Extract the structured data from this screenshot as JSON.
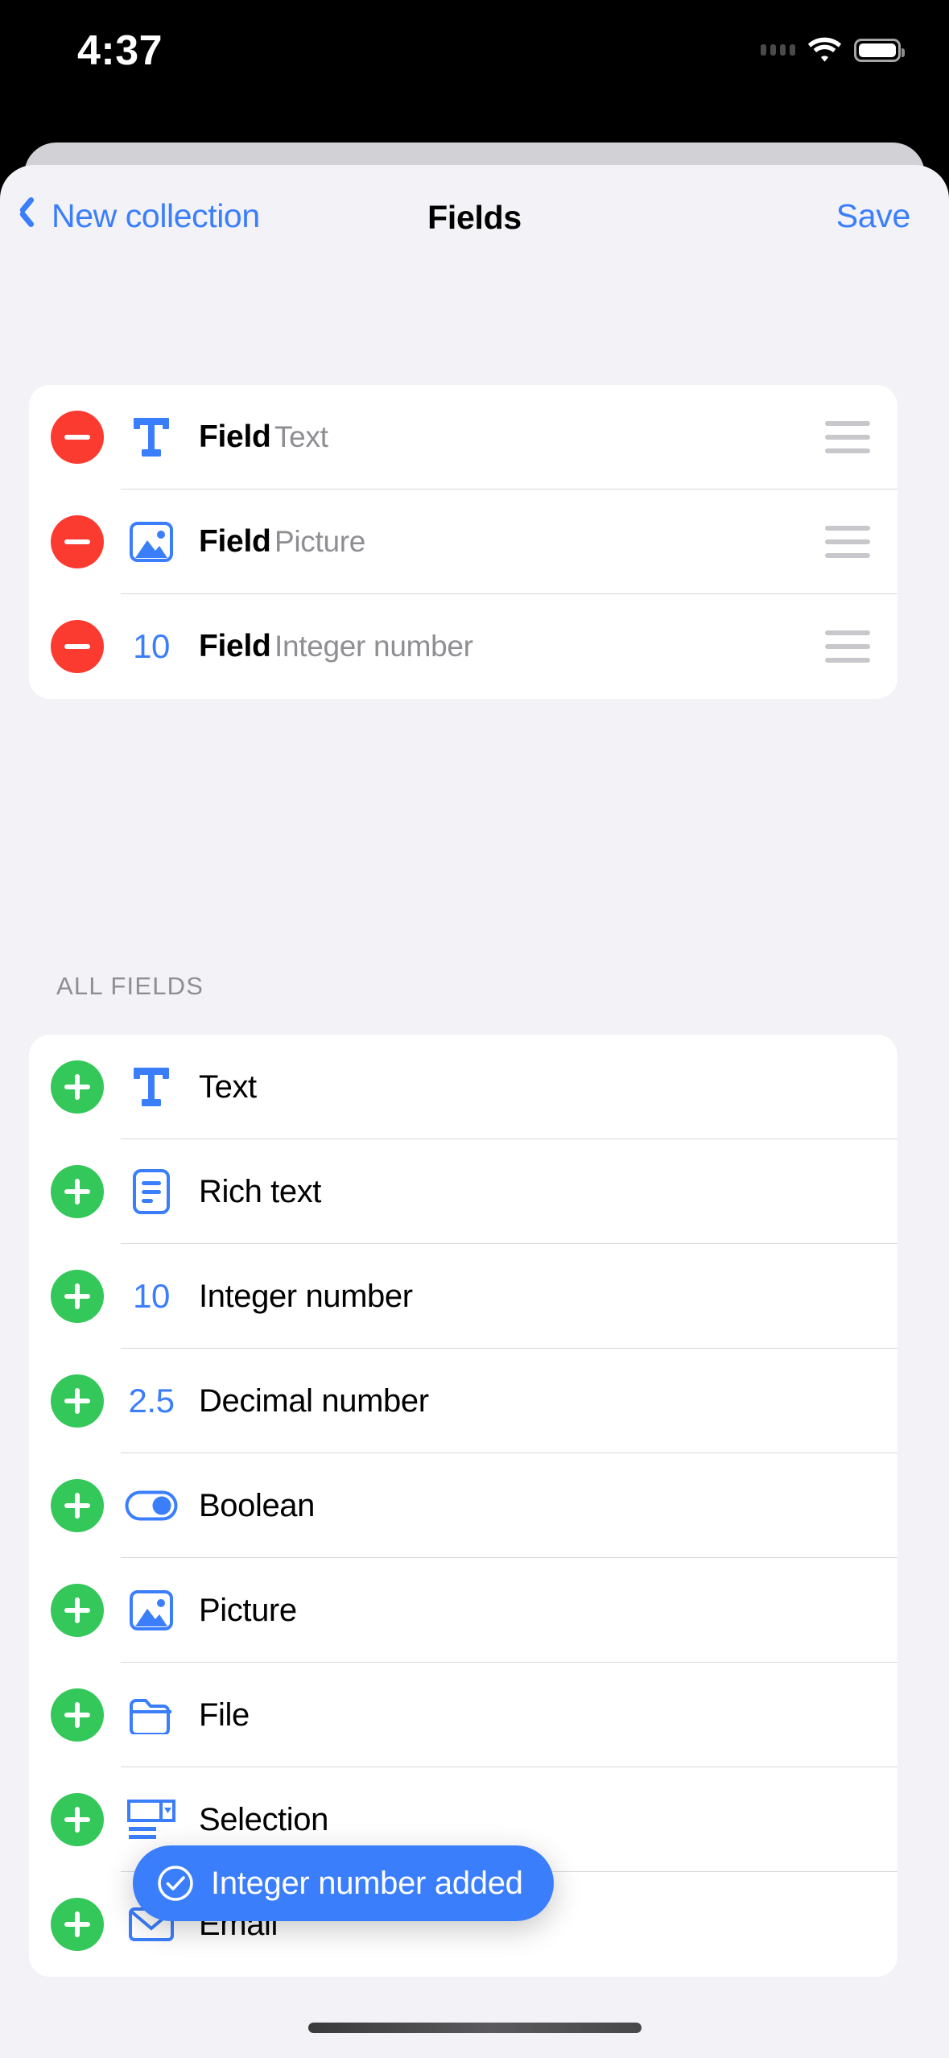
{
  "status_bar": {
    "time": "4:37",
    "wifi_icon": "wifi-icon",
    "battery_icon": "battery-icon",
    "signal_icon": "signal-dots-icon"
  },
  "nav": {
    "back_label": "New collection",
    "back_icon": "chevron-left-icon",
    "title": "Fields",
    "save_label": "Save"
  },
  "selected_fields": {
    "rows": [
      {
        "remove_icon": "minus-circle-icon",
        "type_icon": "text-T-icon",
        "title": "Field",
        "subtitle": "Text",
        "grip_icon": "drag-handle-icon"
      },
      {
        "remove_icon": "minus-circle-icon",
        "type_icon": "picture-icon",
        "title": "Field",
        "subtitle": "Picture",
        "grip_icon": "drag-handle-icon"
      },
      {
        "remove_icon": "minus-circle-icon",
        "type_icon": "integer-10-icon",
        "title": "Field",
        "subtitle": "Integer number",
        "grip_icon": "drag-handle-icon"
      }
    ]
  },
  "all_fields": {
    "header": "ALL FIELDS",
    "rows": [
      {
        "add_icon": "plus-circle-icon",
        "type_icon": "text-T-icon",
        "label": "Text"
      },
      {
        "add_icon": "plus-circle-icon",
        "type_icon": "rich-text-icon",
        "label": "Rich text"
      },
      {
        "add_icon": "plus-circle-icon",
        "type_icon": "integer-10-icon",
        "label": "Integer number"
      },
      {
        "add_icon": "plus-circle-icon",
        "type_icon": "decimal-2-5-icon",
        "label": "Decimal number"
      },
      {
        "add_icon": "plus-circle-icon",
        "type_icon": "toggle-icon",
        "label": "Boolean"
      },
      {
        "add_icon": "plus-circle-icon",
        "type_icon": "picture-icon",
        "label": "Picture"
      },
      {
        "add_icon": "plus-circle-icon",
        "type_icon": "folder-icon",
        "label": "File"
      },
      {
        "add_icon": "plus-circle-icon",
        "type_icon": "selection-icon",
        "label": "Selection"
      },
      {
        "add_icon": "plus-circle-icon",
        "type_icon": "envelope-icon",
        "label": "Email"
      }
    ],
    "icon_glyphs": {
      "integer": "10",
      "decimal": "2.5"
    }
  },
  "toast": {
    "icon": "check-circle-icon",
    "message": "Integer number added"
  },
  "colors": {
    "accent_blue": "#3b7efc",
    "remove_red": "#fc3b30",
    "add_green": "#34c759",
    "sheet_bg": "#f2f2f7",
    "card_bg": "#ffffff",
    "subtitle_gray": "#8e8e93"
  }
}
